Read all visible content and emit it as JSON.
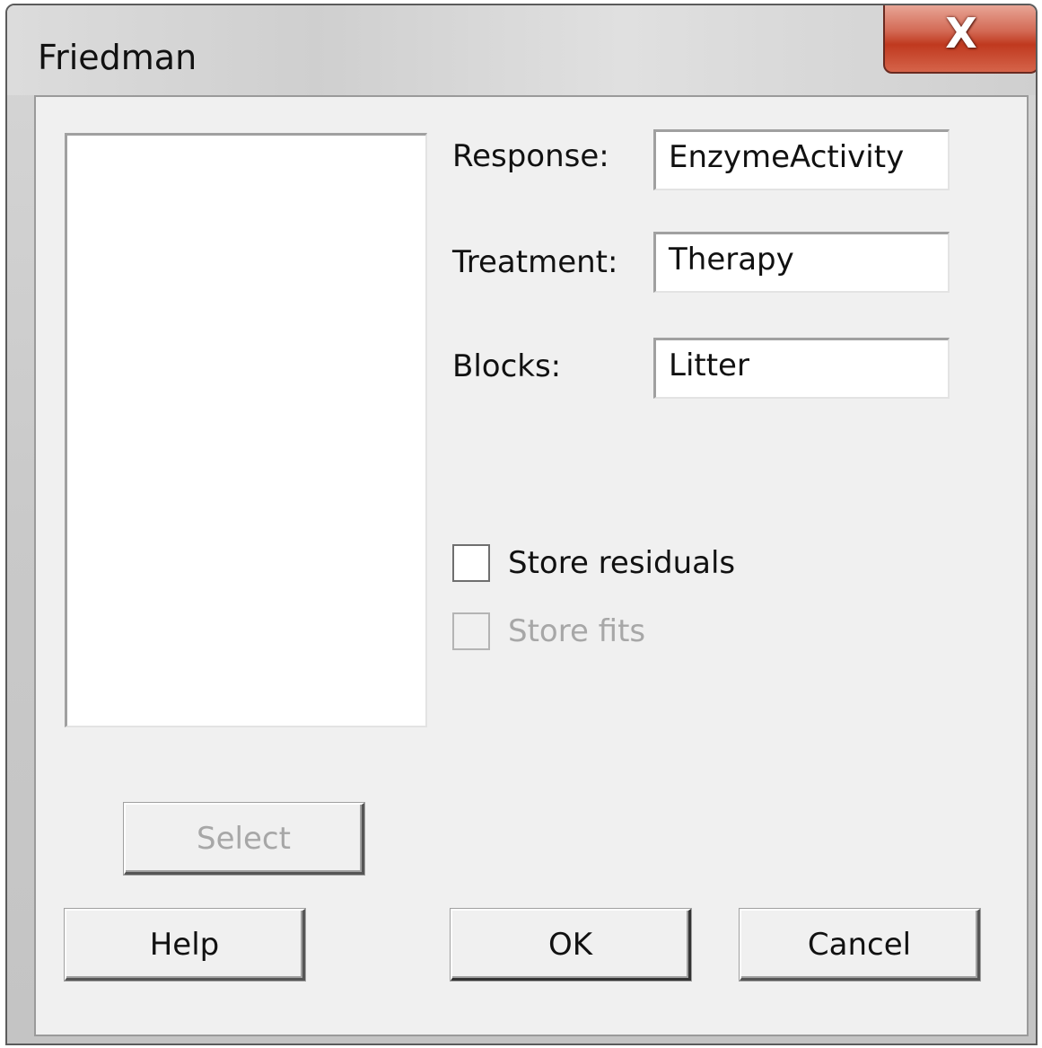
{
  "window": {
    "title": "Friedman",
    "close_label": "X"
  },
  "fields": {
    "response": {
      "label": "Response:",
      "value": "EnzymeActivity"
    },
    "treatment": {
      "label": "Treatment:",
      "value": "Therapy"
    },
    "blocks": {
      "label": "Blocks:",
      "value": "Litter"
    }
  },
  "options": {
    "store_residuals": {
      "label": "Store residuals",
      "checked": false,
      "enabled": true
    },
    "store_fits": {
      "label": "Store fits",
      "checked": false,
      "enabled": false
    }
  },
  "buttons": {
    "select": "Select",
    "help": "Help",
    "ok": "OK",
    "cancel": "Cancel"
  }
}
